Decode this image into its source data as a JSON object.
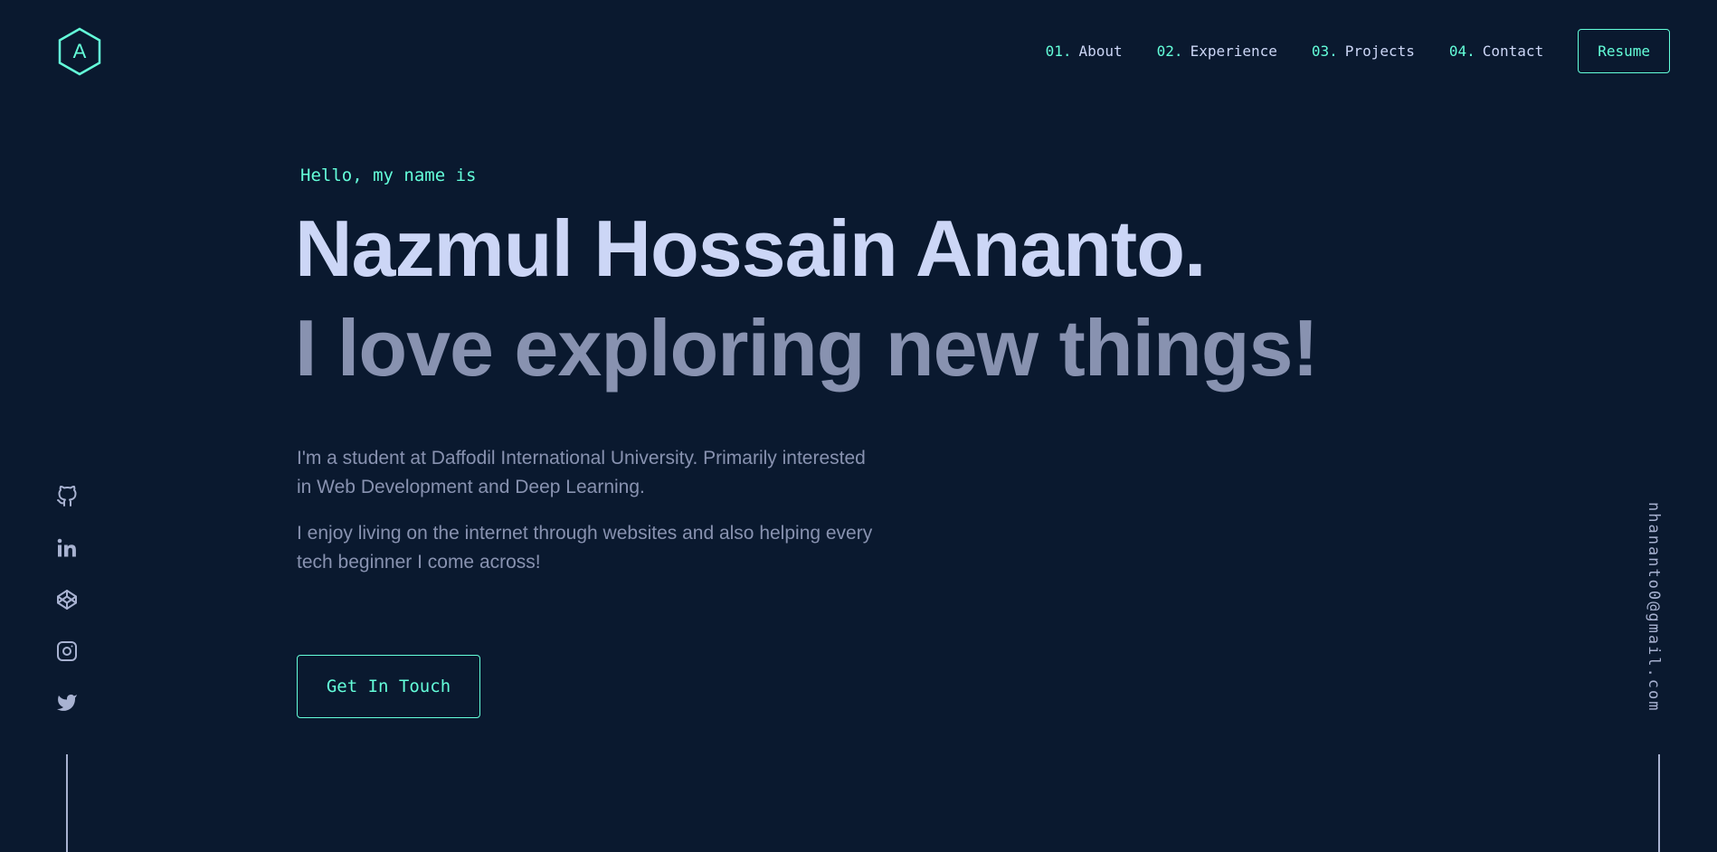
{
  "header": {
    "logo_letter": "A",
    "nav": [
      {
        "num": "01.",
        "label": "About"
      },
      {
        "num": "02.",
        "label": "Experience"
      },
      {
        "num": "03.",
        "label": "Projects"
      },
      {
        "num": "04.",
        "label": "Contact"
      }
    ],
    "resume_label": "Resume"
  },
  "hero": {
    "greeting": "Hello, my name is",
    "name": "Nazmul Hossain Ananto.",
    "tagline": "I love exploring new things!",
    "bio": [
      "I'm a student at Daffodil International University. Primarily interested in Web Development and Deep Learning.",
      "I enjoy living on the internet through websites and also helping every tech beginner I come across!"
    ],
    "cta_label": "Get In Touch"
  },
  "socials": [
    "github-icon",
    "linkedin-icon",
    "codepen-icon",
    "instagram-icon",
    "twitter-icon"
  ],
  "email": "nhananto0@gmail.com",
  "colors": {
    "background": "#0a192f",
    "accent": "#64ffda",
    "heading": "#ccd6f6",
    "text": "#8892b0",
    "icon": "#a8b2d1"
  }
}
